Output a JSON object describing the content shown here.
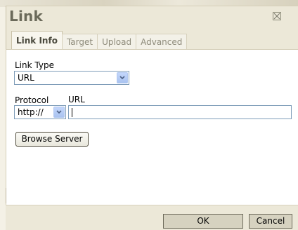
{
  "dialog": {
    "title": "Link"
  },
  "tabs": [
    {
      "label": "Link Info",
      "active": true
    },
    {
      "label": "Target",
      "active": false
    },
    {
      "label": "Upload",
      "active": false
    },
    {
      "label": "Advanced",
      "active": false
    }
  ],
  "link_info": {
    "link_type_label": "Link Type",
    "link_type_value": "URL",
    "protocol_label": "Protocol",
    "protocol_value": "http://",
    "url_label": "URL",
    "url_value": "",
    "browse_button": "Browse Server"
  },
  "footer": {
    "ok_label": "OK",
    "cancel_label": "Cancel"
  },
  "icons": {
    "close": "close-icon",
    "dropdown": "chevron-down-icon"
  },
  "colors": {
    "dialog_bg": "#ece8d8",
    "title": "#6b6a5a",
    "input_border": "#7f9db9",
    "dropdown_button": "#c3d6fb"
  }
}
